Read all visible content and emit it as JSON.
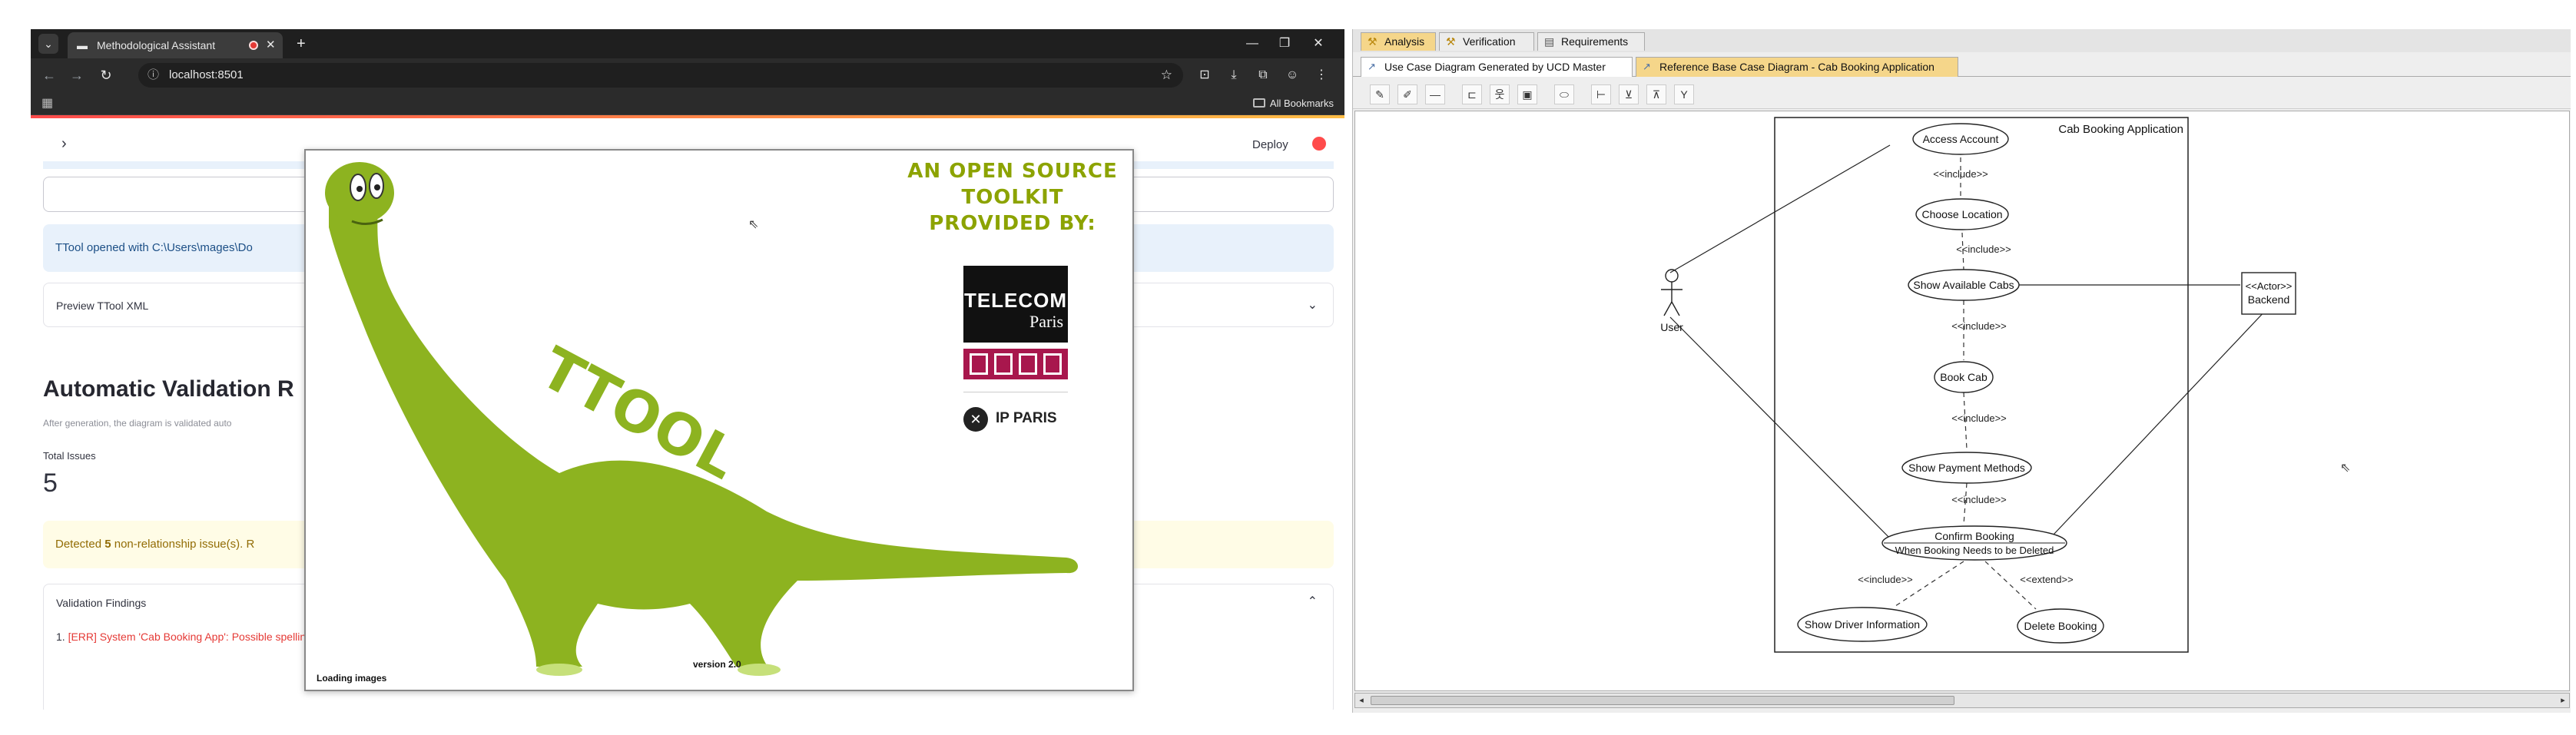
{
  "browser": {
    "tab_title": "Methodological Assistant",
    "new_tab": "+",
    "url": "localhost:8501",
    "all_bookmarks": "All Bookmarks",
    "controls": {
      "minimize": "—",
      "restore": "❐",
      "close": "✕"
    }
  },
  "app": {
    "deploy": "Deploy",
    "info_message": "TTool opened with C:\\Users\\mages\\Do",
    "preview_label": "Preview TTool XML",
    "section_title": "Automatic Validation R",
    "section_caption": "After generation, the diagram is validated auto",
    "metric_label": "Total Issues",
    "metric_value": "5",
    "warning_prefix": "Detected ",
    "warning_count": "5",
    "warning_suffix": " non-relationship issue(s). R",
    "findings_label": "Validation Findings",
    "finding_number": "1. ",
    "finding_text": "[ERR] System 'Cab Booking App': Possible spelling error in system name: 'App' — did you mean 'Yapp'?"
  },
  "splash": {
    "tagline_lines": [
      "AN OPEN SOURCE",
      "TOOLKIT",
      "PROVIDED BY:"
    ],
    "logo_text": "TTOOL",
    "telecom_line1": "TELECOM",
    "telecom_line2": "Paris",
    "ip_paris": "IP PARIS",
    "version": "version 2.0",
    "loading": "Loading images",
    "dino_color": "#8db320"
  },
  "ttool": {
    "main_tabs": [
      "Analysis",
      "Verification",
      "Requirements"
    ],
    "sub_tabs": [
      "Use Case Diagram Generated by UCD Master",
      "Reference Base Case Diagram - Cab Booking Application"
    ],
    "active_color": "#f5d68a",
    "diagram": {
      "system_name": "Cab Booking Application",
      "actors": [
        {
          "label": "User"
        },
        {
          "label_line1": "<<Actor>>",
          "label_line2": "Backend"
        }
      ],
      "use_cases": [
        "Access Account",
        "Choose Location",
        "Show Available Cabs",
        "Book Cab",
        "Show Payment Methods",
        "Confirm Booking",
        "Show Driver Information",
        "Delete Booking"
      ],
      "extension_point": "When Booking Needs to be Deleted",
      "include_label": "<<include>>",
      "extend_label": "<<extend>>"
    }
  }
}
